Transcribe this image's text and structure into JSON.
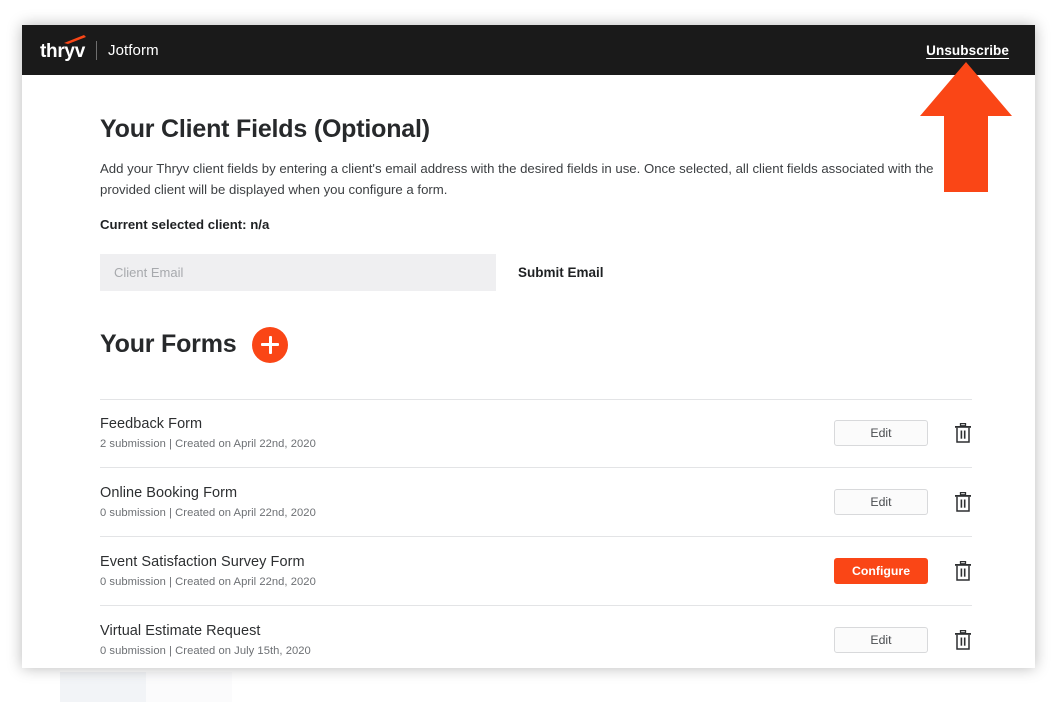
{
  "header": {
    "brand_primary": "thryv",
    "brand_secondary": "Jotform",
    "unsubscribe_label": "Unsubscribe"
  },
  "client_fields": {
    "title": "Your Client Fields (Optional)",
    "description": "Add your Thryv client fields by entering a client's email address with the desired fields in use. Once selected, all client fields associated with the provided client will be displayed when you configure a form.",
    "current_client_label": "Current selected client: n/a",
    "email_placeholder": "Client Email",
    "email_value": "",
    "submit_label": "Submit Email"
  },
  "forms_section": {
    "title": "Your Forms",
    "add_icon": "plus-icon",
    "rows": [
      {
        "name": "Feedback Form",
        "meta": "2 submission | Created on April 22nd, 2020",
        "action_label": "Edit",
        "action_style": "secondary",
        "delete_icon": "trash-icon"
      },
      {
        "name": "Online Booking Form",
        "meta": "0 submission | Created on April 22nd, 2020",
        "action_label": "Edit",
        "action_style": "secondary",
        "delete_icon": "trash-icon"
      },
      {
        "name": "Event Satisfaction Survey Form",
        "meta": "0 submission | Created on April 22nd, 2020",
        "action_label": "Configure",
        "action_style": "primary",
        "delete_icon": "trash-icon"
      },
      {
        "name": "Virtual Estimate Request",
        "meta": "0 submission | Created on July 15th, 2020",
        "action_label": "Edit",
        "action_style": "secondary",
        "delete_icon": "trash-icon"
      }
    ]
  },
  "annotation": {
    "icon": "up-arrow-annotation",
    "points_at": "Unsubscribe"
  },
  "colors": {
    "accent_orange": "#FA4616",
    "header_black": "#1A1A1A",
    "input_gray": "#EFEFF1",
    "divider": "#E3E4E6"
  }
}
